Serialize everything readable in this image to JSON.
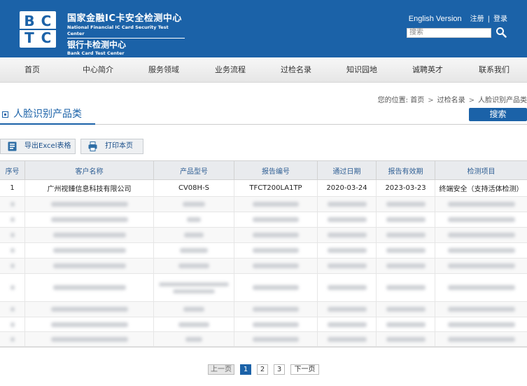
{
  "header": {
    "logo_letters": [
      "B",
      "C",
      "T",
      "C"
    ],
    "org_cn": "国家金融IC卡安全检测中心",
    "org_en": "National Financial IC Card Security Test Center",
    "center_cn": "银行卡检测中心",
    "center_en": "Bank Card Test Center",
    "english_version": "English Version",
    "register": "注册",
    "divider": "|",
    "login": "登录",
    "search_placeholder": "搜索"
  },
  "nav": {
    "items": [
      "首页",
      "中心简介",
      "服务领域",
      "业务流程",
      "过检名录",
      "知识园地",
      "诚聘英才",
      "联系我们"
    ]
  },
  "breadcrumb": {
    "prefix": "您的位置:",
    "items": [
      "首页",
      "过检名录",
      "人脸识别产品类"
    ],
    "separator": ">"
  },
  "section": {
    "title": "人脸识别产品类",
    "search_button": "搜索"
  },
  "toolbar": {
    "export_label": "导出Excel表格",
    "print_label": "打印本页"
  },
  "table": {
    "columns": [
      "序号",
      "客户名称",
      "产品型号",
      "报告编号",
      "通过日期",
      "报告有效期",
      "检测项目"
    ],
    "first_row": {
      "index": "1",
      "customer": "广州视臻信息科技有限公司",
      "model": "CV08H-S",
      "report": "TFCT200LA1TP",
      "pass_date": "2020-03-24",
      "valid_until": "2023-03-23",
      "item": "终端安全（支持活体检测）"
    }
  },
  "pagination": {
    "prev": "上一页",
    "pages": [
      "1",
      "2",
      "3"
    ],
    "current": "1",
    "next": "下一页"
  },
  "colors": {
    "brand_blue": "#1b62a8",
    "header_bg": "#1b62a8"
  }
}
